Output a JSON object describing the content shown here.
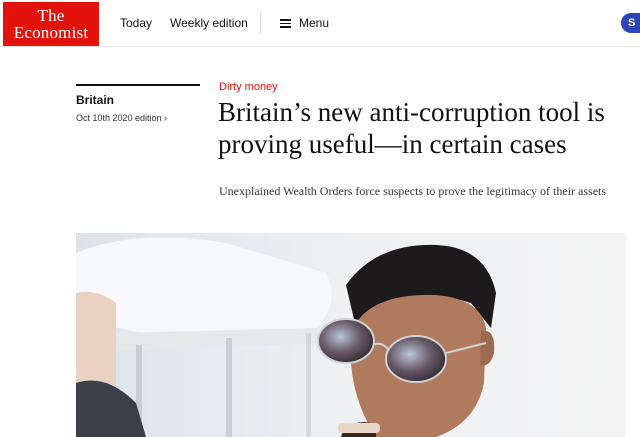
{
  "header": {
    "logo_line1": "The",
    "logo_line2": "Economist",
    "nav": [
      "Today",
      "Weekly edition"
    ],
    "menu_label": "Menu",
    "subscribe_label": "S"
  },
  "section": {
    "name": "Britain",
    "edition": "Oct 10th 2020 edition ›"
  },
  "article": {
    "rubric": "Dirty money",
    "headline": "Britain’s new anti-corruption tool is proving useful—in certain cases",
    "standfirst": "Unexplained Wealth Orders force suspects to prove the legitimacy of their assets"
  },
  "colors": {
    "brand_red": "#e3120b",
    "subscribe_blue": "#2e45b8"
  },
  "icons": {
    "menu": "hamburger-icon"
  }
}
